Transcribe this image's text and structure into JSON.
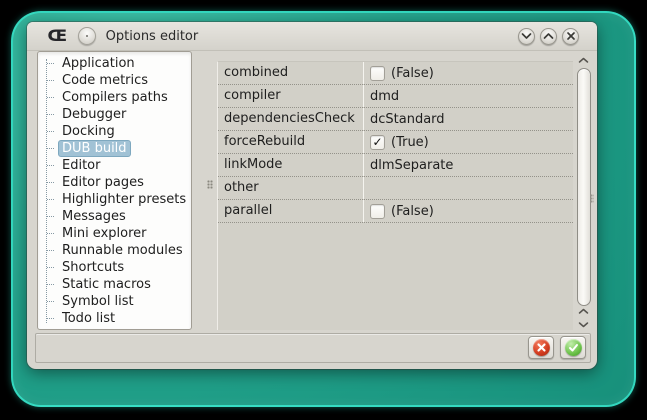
{
  "window": {
    "title": "Options editor",
    "logo_glyph": "Œ",
    "controls": [
      {
        "name": "minimize",
        "icon": "chevron-down-icon"
      },
      {
        "name": "maximize",
        "icon": "chevron-up-icon"
      },
      {
        "name": "close",
        "icon": "close-icon"
      }
    ]
  },
  "sidebar": {
    "items": [
      {
        "label": "Application",
        "selected": false
      },
      {
        "label": "Code metrics",
        "selected": false
      },
      {
        "label": "Compilers paths",
        "selected": false
      },
      {
        "label": "Debugger",
        "selected": false
      },
      {
        "label": "Docking",
        "selected": false
      },
      {
        "label": "DUB build",
        "selected": true
      },
      {
        "label": "Editor",
        "selected": false
      },
      {
        "label": "Editor pages",
        "selected": false
      },
      {
        "label": "Highlighter presets",
        "selected": false
      },
      {
        "label": "Messages",
        "selected": false
      },
      {
        "label": "Mini explorer",
        "selected": false
      },
      {
        "label": "Runnable modules",
        "selected": false
      },
      {
        "label": "Shortcuts",
        "selected": false
      },
      {
        "label": "Static macros",
        "selected": false
      },
      {
        "label": "Symbol list",
        "selected": false
      },
      {
        "label": "Todo list",
        "selected": false
      }
    ]
  },
  "properties": {
    "rows": [
      {
        "name": "combined",
        "type": "checkbox",
        "checked": false,
        "value": "(False)"
      },
      {
        "name": "compiler",
        "type": "text",
        "checked": null,
        "value": "dmd"
      },
      {
        "name": "dependenciesCheck",
        "type": "text",
        "checked": null,
        "value": "dcStandard"
      },
      {
        "name": "forceRebuild",
        "type": "checkbox",
        "checked": true,
        "value": "(True)"
      },
      {
        "name": "linkMode",
        "type": "text",
        "checked": null,
        "value": "dlmSeparate"
      },
      {
        "name": "other",
        "type": "text",
        "checked": null,
        "value": ""
      },
      {
        "name": "parallel",
        "type": "checkbox",
        "checked": false,
        "value": "(False)"
      }
    ],
    "check_glyph": "✓"
  },
  "footer": {
    "buttons": [
      {
        "name": "cancel",
        "icon": "cancel-circle-icon",
        "color": "#cf3b22"
      },
      {
        "name": "accept",
        "icon": "accept-circle-icon",
        "color": "#58b748"
      }
    ]
  },
  "colors": {
    "desktop_teal": "#1fa189",
    "desktop_border": "#3ae4ca",
    "dialog_bg": "#d7d5ce",
    "grid_bg": "#d2d0c8",
    "selection_bg": "#a1c2d5",
    "selection_border": "#7ea8bf",
    "cancel_red": "#cf3b22",
    "accept_green": "#58b748"
  }
}
